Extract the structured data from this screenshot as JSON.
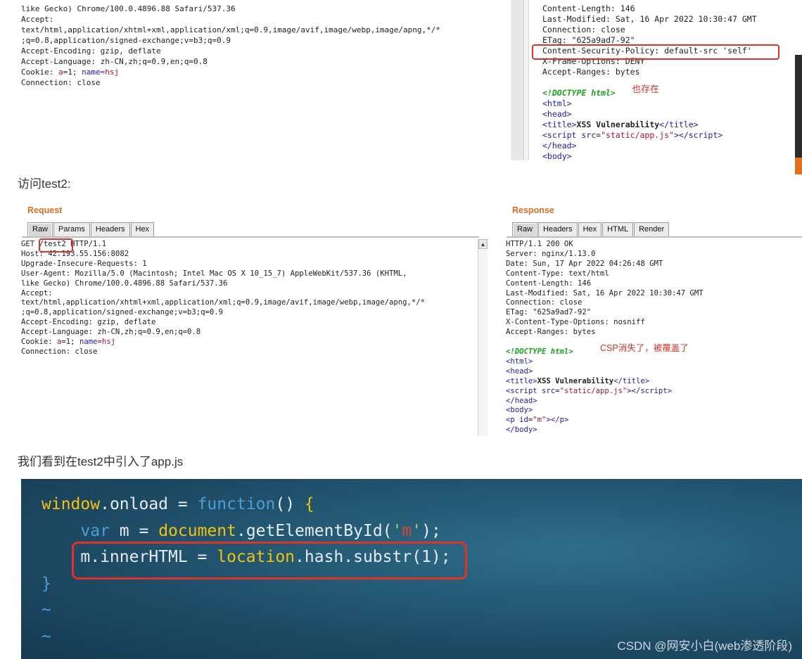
{
  "top_request": {
    "lines": [
      "like Gecko) Chrome/100.0.4896.88 Safari/537.36",
      "Accept:",
      "text/html,application/xhtml+xml,application/xml;q=0.9,image/avif,image/webp,image/apng,*/*",
      ";q=0.8,application/signed-exchange;v=b3;q=0.9",
      "Accept-Encoding: gzip, deflate",
      "Accept-Language: zh-CN,zh;q=0.9,en;q=0.8"
    ],
    "cookie_prefix": "Cookie: ",
    "cookie_a_key": "a",
    "cookie_a_val": "=1; ",
    "cookie_name_key": "name",
    "cookie_name_val": "=hsj",
    "last_line": "Connection: close"
  },
  "top_response": {
    "lines": [
      "Content-Length: 146",
      "Last-Modified: Sat, 16 Apr 2022 10:30:47 GMT",
      "Connection: close",
      "ETag: \"625a9ad7-92\"",
      "Content-Security-Policy: default-src 'self'",
      "X-Frame-Options: DENY",
      "Accept-Ranges: bytes"
    ],
    "doctype": "<!DOCTYPE html>",
    "annotation": "也存在",
    "title_text": "XSS Vulnerability",
    "script_src": "\"static/app.js\""
  },
  "paragraph1": "访问test2:",
  "request_pane": {
    "title": "Request",
    "tabs": [
      "Raw",
      "Params",
      "Headers",
      "Hex"
    ],
    "first_line": "GET /test2 HTTP/1.1",
    "lines": [
      "Host: 42.193.55.156:8082",
      "Upgrade-Insecure-Requests: 1",
      "User-Agent: Mozilla/5.0 (Macintosh; Intel Mac OS X 10_15_7) AppleWebKit/537.36 (KHTML,",
      "like Gecko) Chrome/100.0.4896.88 Safari/537.36",
      "Accept:",
      "text/html,application/xhtml+xml,application/xml;q=0.9,image/avif,image/webp,image/apng,*/*",
      ";q=0.8,application/signed-exchange;v=b3;q=0.9",
      "Accept-Encoding: gzip, deflate",
      "Accept-Language: zh-CN,zh;q=0.9,en;q=0.8"
    ],
    "cookie_prefix": "Cookie: ",
    "cookie_a_key": "a",
    "cookie_a_val": "=1; ",
    "cookie_name_key": "name",
    "cookie_name_val": "=hsj",
    "last_line": "Connection: close"
  },
  "response_pane": {
    "title": "Response",
    "tabs": [
      "Raw",
      "Headers",
      "Hex",
      "HTML",
      "Render"
    ],
    "lines": [
      "HTTP/1.1 200 OK",
      "Server: nginx/1.13.0",
      "Date: Sun, 17 Apr 2022 04:26:48 GMT",
      "Content-Type: text/html",
      "Content-Length: 146",
      "Last-Modified: Sat, 16 Apr 2022 10:30:47 GMT",
      "Connection: close",
      "ETag: \"625a9ad7-92\"",
      "X-Content-Type-Options: nosniff",
      "Accept-Ranges: bytes"
    ],
    "doctype": "<!DOCTYPE html>",
    "annotation": "CSP消失了，被覆盖了",
    "title_text": "XSS Vulnerability",
    "script_src": "\"static/app.js\"",
    "p_id": "\"m\""
  },
  "paragraph2": "我们看到在test2中引入了app.js",
  "code": {
    "watermark": "CSDN @网安小白(web渗透阶段)"
  },
  "colors": {
    "annotation_red": "#e0322a",
    "burp_orange": "#e26c22",
    "code_bg": "#1c4660"
  }
}
